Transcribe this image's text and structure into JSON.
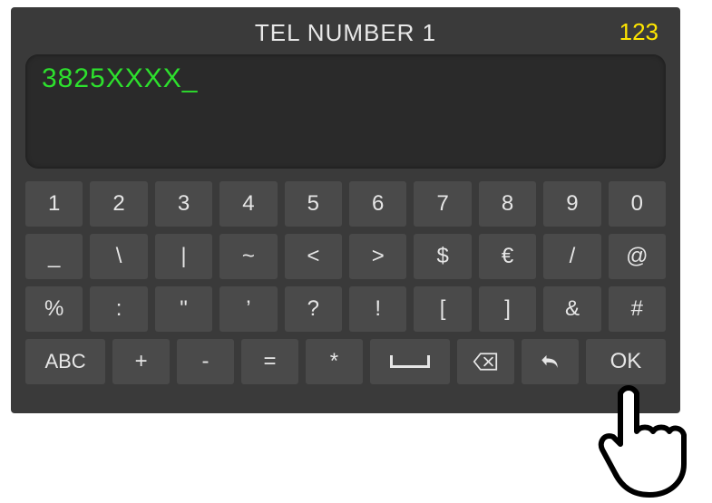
{
  "header": {
    "title": "TEL NUMBER 1",
    "mode": "123"
  },
  "input": {
    "value": "3825XXXX",
    "cursor": "_"
  },
  "keyboard": {
    "row1": [
      "1",
      "2",
      "3",
      "4",
      "5",
      "6",
      "7",
      "8",
      "9",
      "0"
    ],
    "row2": [
      "_",
      "\\",
      "|",
      "~",
      "<",
      ">",
      "$",
      "€",
      "/",
      "@"
    ],
    "row3": [
      "%",
      ":",
      "\"",
      "’",
      "?",
      "!",
      "[",
      "]",
      "&",
      "#"
    ],
    "row4": {
      "abc": "ABC",
      "plus": "+",
      "minus": "-",
      "equals": "=",
      "asterisk": "*",
      "space": "space",
      "backspace": "backspace",
      "undo": "undo",
      "ok": "OK"
    }
  }
}
